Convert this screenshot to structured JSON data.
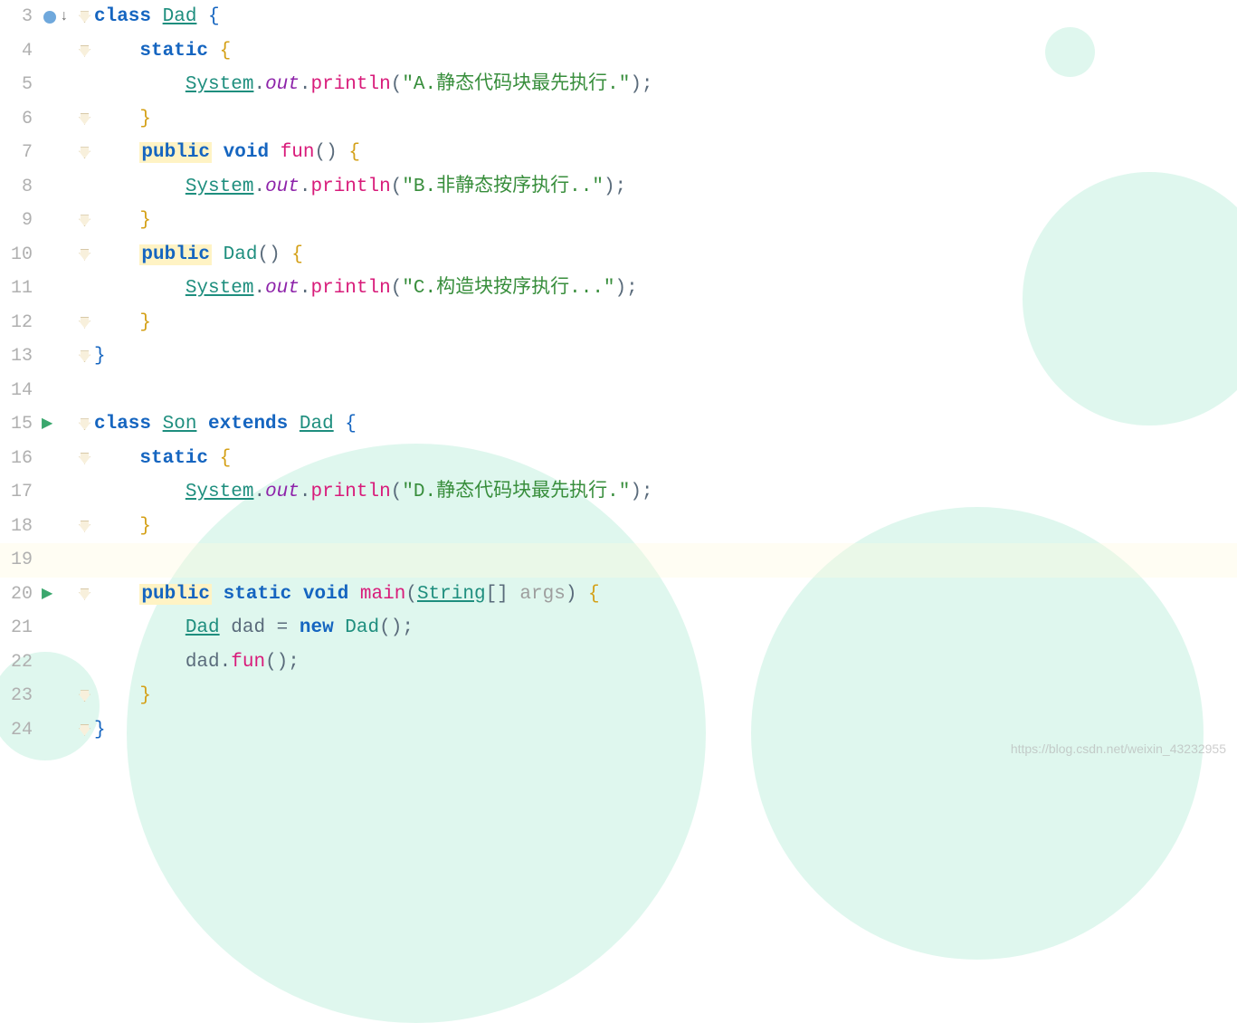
{
  "watermark": "https://blog.csdn.net/weixin_43232955",
  "tokens": {
    "class": "class",
    "static": "static",
    "public": "public",
    "void": "void",
    "extends": "extends",
    "new": "new",
    "Dad": "Dad",
    "Son": "Son",
    "System": "System",
    "out": "out",
    "println": "println",
    "fun": "fun",
    "main": "main",
    "String": "String",
    "args": "args",
    "dad": "dad"
  },
  "strings": {
    "a": "\"A.静态代码块最先执行.\"",
    "b": "\"B.非静态按序执行..\"",
    "c": "\"C.构造块按序执行...\"",
    "d": "\"D.静态代码块最先执行.\""
  },
  "lines": {
    "3": "3",
    "4": "4",
    "5": "5",
    "6": "6",
    "7": "7",
    "8": "8",
    "9": "9",
    "10": "10",
    "11": "11",
    "12": "12",
    "13": "13",
    "14": "14",
    "15": "15",
    "16": "16",
    "17": "17",
    "18": "18",
    "19": "19",
    "20": "20",
    "21": "21",
    "22": "22",
    "23": "23",
    "24": "24"
  }
}
